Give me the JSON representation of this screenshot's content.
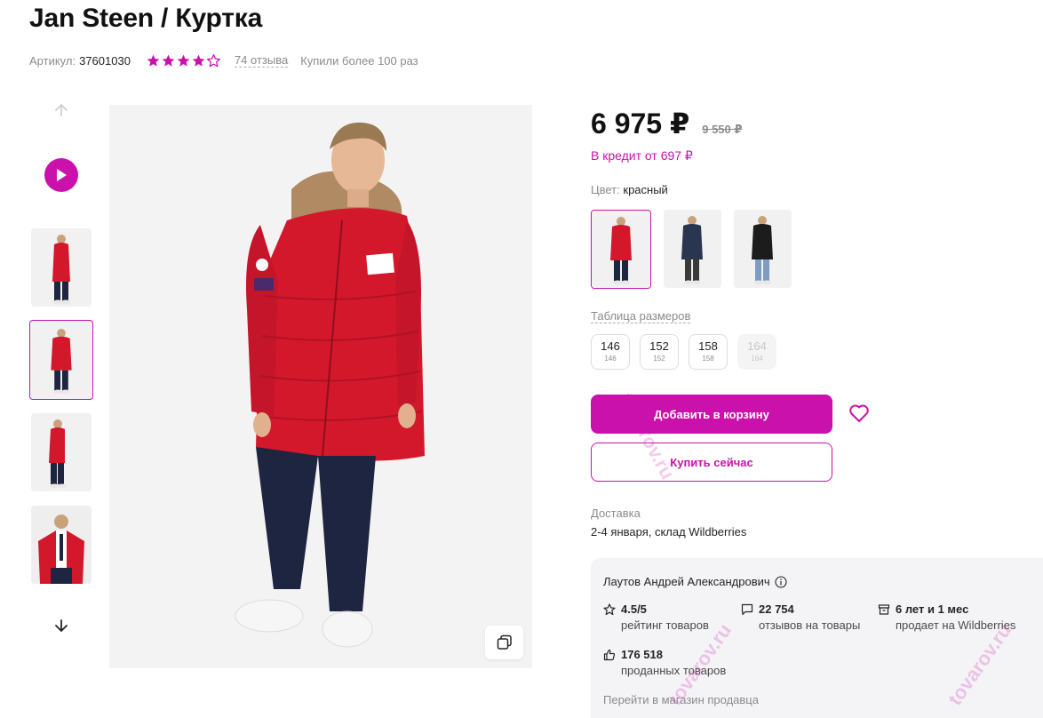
{
  "product": {
    "title": "Jan Steen / Куртка",
    "article_label": "Артикул:",
    "article_value": "37601030",
    "rating": 4,
    "rating_max": 5,
    "reviews_link": "74 отзыва",
    "bought_text": "Купили более 100 раз"
  },
  "pricing": {
    "price": "6 975 ₽",
    "old_price": "9 550 ₽",
    "credit": "В кредит от 697 ₽"
  },
  "color": {
    "label": "Цвет:",
    "value": "красный",
    "options": [
      "red",
      "navy",
      "black"
    ],
    "selected_index": 0
  },
  "sizes": {
    "table_link": "Таблица размеров",
    "options": [
      {
        "main": "146",
        "sub": "146",
        "available": true
      },
      {
        "main": "152",
        "sub": "152",
        "available": true
      },
      {
        "main": "158",
        "sub": "158",
        "available": true
      },
      {
        "main": "164",
        "sub": "164",
        "available": false
      }
    ]
  },
  "actions": {
    "add_to_cart": "Добавить в корзину",
    "buy_now": "Купить сейчас"
  },
  "delivery": {
    "label": "Доставка",
    "value": "2-4 января, склад Wildberries"
  },
  "seller": {
    "name": "Лаутов Андрей Александрович",
    "stats": [
      {
        "value": "4.5/5",
        "label": "рейтинг товаров",
        "icon": "star-outline-icon"
      },
      {
        "value": "22 754",
        "label": "отзывов на товары",
        "icon": "chat-icon"
      },
      {
        "value": "6 лет и 1 мес",
        "label": "продает на Wildberries",
        "icon": "store-box-icon"
      },
      {
        "value": "176 518",
        "label": "проданных товаров",
        "icon": "thumbs-up-icon"
      }
    ],
    "store_link": "Перейти в магазин продавца"
  },
  "gallery": {
    "thumbnail_count": 4,
    "active_thumbnail": 1
  },
  "colors": {
    "accent": "#cb11ab",
    "jacket_red": "#d3182b",
    "pants_navy": "#1d2540"
  },
  "watermark": "tovarov.ru"
}
